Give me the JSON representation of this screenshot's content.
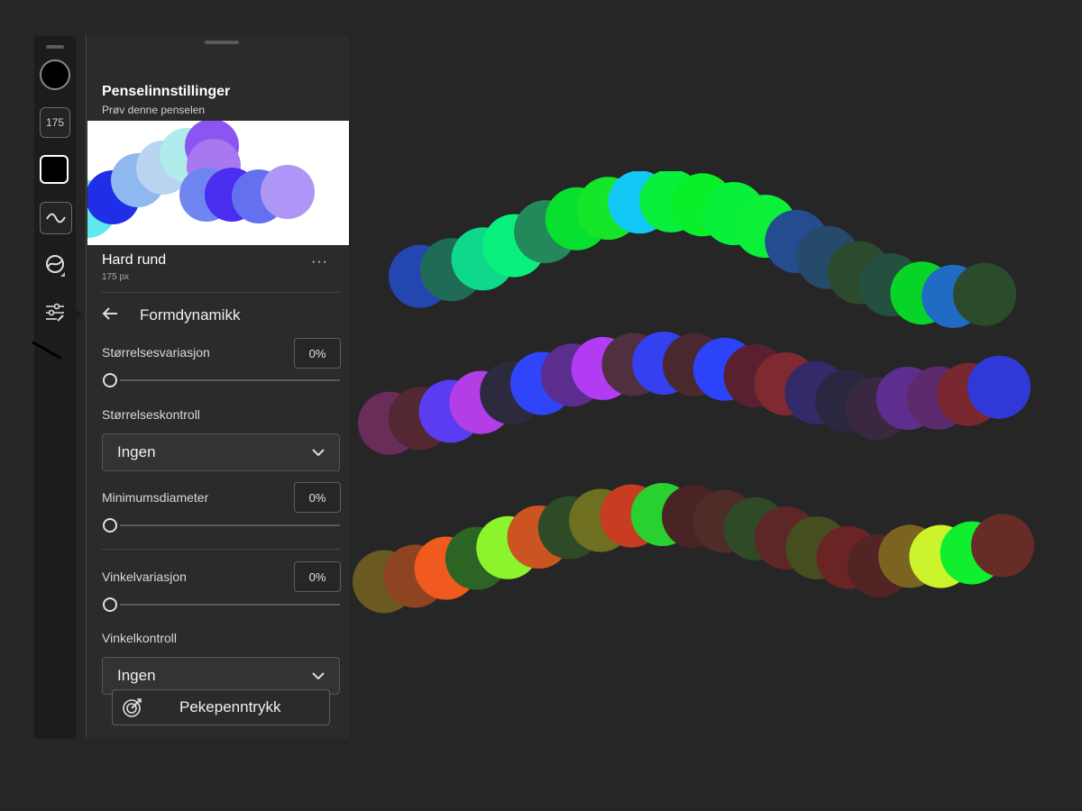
{
  "rail": {
    "brush_size": "175"
  },
  "panel": {
    "title": "Penselinnstillinger",
    "subtitle": "Prøv denne penselen",
    "brush_name": "Hard rund",
    "brush_size": "175 px",
    "more_label": "···",
    "section_title": "Formdynamikk",
    "size_variation": {
      "label": "Størrelsesvariasjon",
      "value": "0%"
    },
    "size_control": {
      "label": "Størrelseskontroll",
      "value": "Ingen"
    },
    "min_diameter": {
      "label": "Minimumsdiameter",
      "value": "0%"
    },
    "angle_variation": {
      "label": "Vinkelvariasjon",
      "value": "0%"
    },
    "angle_control": {
      "label": "Vinkelkontroll",
      "value": "Ingen"
    },
    "stylus_button": "Pekepenntrykk"
  },
  "colors": {
    "accent": "#ffffff",
    "panel_bg": "#2b2b2b",
    "page_bg": "#262626",
    "preview_strokes": [
      "#5ee8f0",
      "#1f2fe6",
      "#8fb8f0",
      "#b8d4ee",
      "#b0ecec",
      "#8a55f0",
      "#a878f0",
      "#6f86f0",
      "#4a2ef0",
      "#6470f0",
      "#ad96f5"
    ],
    "stroke_rows": [
      [
        "#2446b0",
        "#1f6b55",
        "#0fd88a",
        "#0af07c",
        "#23895a",
        "#08e030",
        "#16e62a",
        "#12c8f4",
        "#09f03c",
        "#09f02a",
        "#08f03a",
        "#0cf038",
        "#244c8e",
        "#254a6a",
        "#2c4a2c",
        "#245040",
        "#08d428",
        "#206cc4",
        "#2a4c2a"
      ],
      [
        "#6a2d5a",
        "#532833",
        "#5b3cf0",
        "#b33ee6",
        "#2c2a3c",
        "#2f45fa",
        "#5b2e8e",
        "#b23cf3",
        "#503040",
        "#3540f0",
        "#4a2830",
        "#2c43fa",
        "#5b2030",
        "#7e2a30",
        "#332a6a",
        "#2a2840",
        "#3a2840",
        "#5e2e8e",
        "#5e2a6e",
        "#7a2830",
        "#3038d8"
      ],
      [
        "#6a5a22",
        "#8e4420",
        "#f05a1e",
        "#2c6424",
        "#8cf42a",
        "#cc5422",
        "#2e4a26",
        "#6e7020",
        "#c83c22",
        "#28d030",
        "#4a2424",
        "#4e2c28",
        "#2e4a26",
        "#5e2626",
        "#444e1e",
        "#6a2424",
        "#522424",
        "#7a6420",
        "#ccf42c",
        "#10ee2e",
        "#672c26"
      ]
    ]
  }
}
